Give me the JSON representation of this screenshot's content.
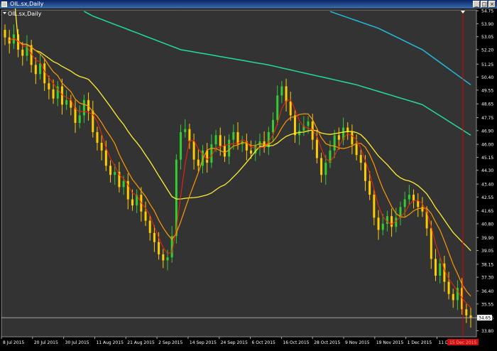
{
  "window": {
    "title": "OIL.sx,Daily",
    "controls": {
      "minimize": "_",
      "maximize": "□",
      "close": "×"
    }
  },
  "colors": {
    "background": "#000000",
    "plot_background": "#333333",
    "text": "#ffffff",
    "bull_candle": "#33cc33",
    "bear_candle": "#ffcc00",
    "ma_fast": "#ff2200",
    "ma_mid": "#ff9900",
    "ma_slow": "#ffee33",
    "ma_100": "#22dd99",
    "ma_200": "#22bbdd",
    "cursor_line": "#dd0000",
    "price_line": "#cccccc"
  },
  "chart_data": {
    "type": "candlestick",
    "symbol_label": "OIL.sx,Daily",
    "y_ticks": [
      "54.75",
      "53.90",
      "53.05",
      "52.20",
      "51.25",
      "50.40",
      "49.55",
      "48.65",
      "47.75",
      "46.90",
      "46.00",
      "45.15",
      "44.30",
      "43.40",
      "42.55",
      "41.65",
      "40.80",
      "39.90",
      "39.05",
      "38.15",
      "37.30",
      "36.40",
      "35.55",
      "34.65",
      "33.80"
    ],
    "ylim": [
      33.4,
      54.8
    ],
    "current_price": "34.65",
    "x_ticks": [
      "8 Jul 2015",
      "20 Jul 2015",
      "30 Jul 2015",
      "11 Aug 2015",
      "21 Aug 2015",
      "2 Sep 2015",
      "14 Sep 2015",
      "24 Sep 2015",
      "6 Oct 2015",
      "16 Oct 2015",
      "28 Oct 2015",
      "9 Nov 2015",
      "19 Nov 2015",
      "1 Dec 2015",
      "11 Dec 2015"
    ],
    "cursor_date_label": "15 Dec 2015",
    "closes": [
      53.0,
      52.6,
      53.2,
      52.2,
      51.8,
      52.5,
      51.2,
      50.6,
      51.3,
      50.0,
      49.6,
      49.0,
      49.8,
      48.6,
      48.9,
      48.4,
      47.4,
      47.9,
      48.9,
      48.2,
      46.8,
      46.1,
      45.6,
      44.6,
      44.0,
      44.2,
      43.2,
      43.6,
      42.4,
      42.0,
      42.7,
      41.6,
      41.0,
      40.2,
      39.6,
      38.8,
      38.4,
      38.6,
      40.0,
      45.0,
      46.8,
      47.0,
      46.2,
      45.0,
      44.6,
      45.6,
      44.8,
      46.0,
      46.6,
      45.9,
      45.2,
      46.3,
      46.8,
      46.0,
      46.2,
      45.6,
      45.4,
      45.9,
      46.2,
      45.8,
      46.8,
      47.6,
      49.2,
      49.8,
      48.8,
      47.9,
      46.6,
      46.9,
      47.2,
      47.5,
      46.3,
      45.1,
      44.0,
      44.8,
      45.6,
      46.6,
      46.3,
      47.1,
      46.8,
      46.0,
      45.3,
      44.8,
      43.6,
      42.7,
      41.2,
      40.4,
      40.8,
      41.3,
      40.6,
      41.2,
      41.9,
      42.4,
      42.7,
      42.3,
      41.9,
      41.6,
      40.5,
      38.5,
      37.4,
      38.2,
      37.0,
      36.2,
      35.8,
      36.6,
      35.2,
      34.8,
      34.65
    ],
    "ma_100": [
      {
        "i": 0,
        "v": 57.5
      },
      {
        "i": 20,
        "v": 54.4
      },
      {
        "i": 40,
        "v": 52.2
      },
      {
        "i": 60,
        "v": 51.2
      },
      {
        "i": 80,
        "v": 49.9
      },
      {
        "i": 95,
        "v": 48.6
      },
      {
        "i": 106,
        "v": 46.6
      }
    ],
    "ma_200": [
      {
        "i": 70,
        "v": 55.1
      },
      {
        "i": 85,
        "v": 53.6
      },
      {
        "i": 95,
        "v": 52.2
      },
      {
        "i": 106,
        "v": 49.9
      }
    ]
  }
}
